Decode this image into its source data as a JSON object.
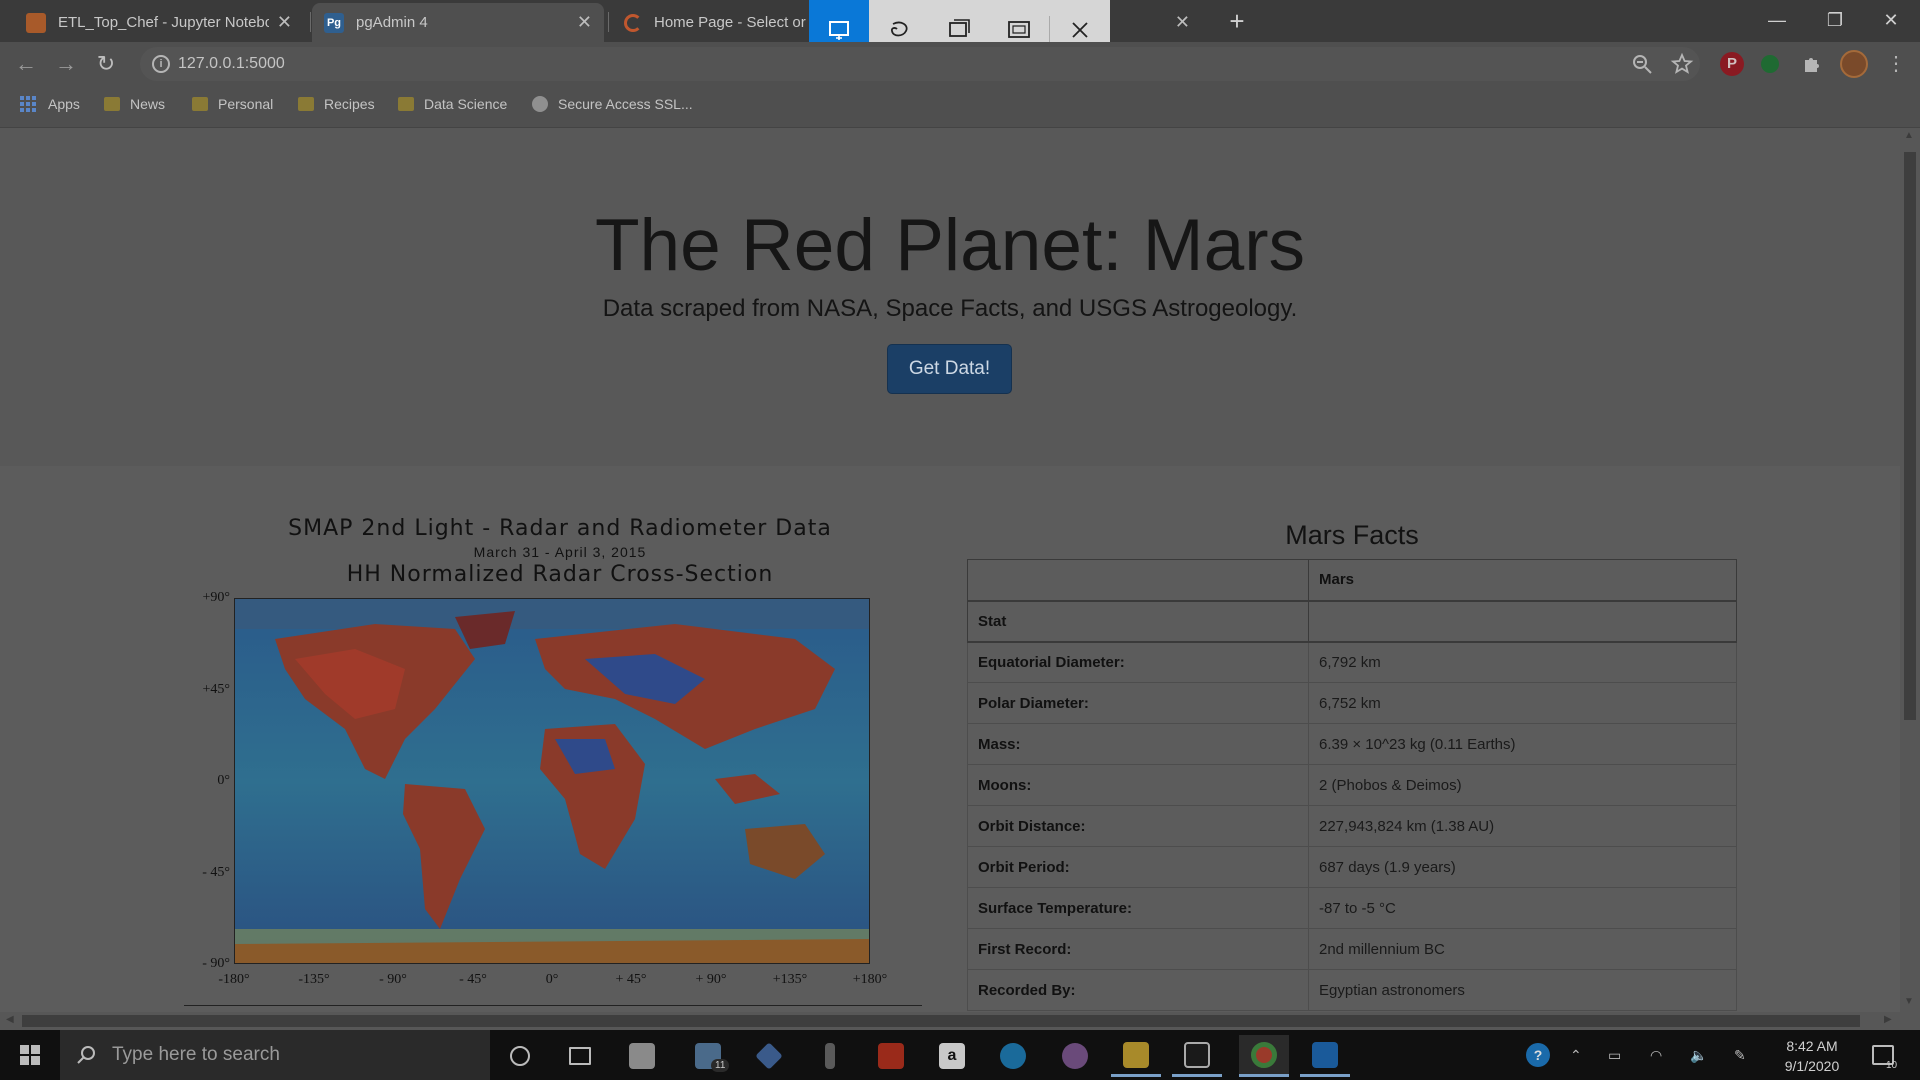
{
  "browser": {
    "tabs": [
      {
        "title": "ETL_Top_Chef - Jupyter Notebook",
        "favicon": "jupyter-icon",
        "color": "#a85a2a"
      },
      {
        "title": "pgAdmin 4",
        "favicon": "pgadmin-icon",
        "color": "#2f5f8f"
      },
      {
        "title": "Home Page - Select or c",
        "favicon": "loading-spinner-icon",
        "color": "#c0572e"
      }
    ],
    "url": "127.0.0.1:5000",
    "bookmarks": [
      {
        "label": "Apps",
        "icon": "apps-grid-icon"
      },
      {
        "label": "News",
        "icon": "folder-icon"
      },
      {
        "label": "Personal",
        "icon": "folder-icon"
      },
      {
        "label": "Recipes",
        "icon": "folder-icon"
      },
      {
        "label": "Data Science",
        "icon": "folder-icon"
      },
      {
        "label": "Secure Access SSL...",
        "icon": "globe-icon"
      }
    ]
  },
  "snip_toolbar": {
    "modes": [
      "rectangular-snip-icon",
      "freeform-snip-icon",
      "window-snip-icon",
      "fullscreen-snip-icon",
      "close-icon"
    ],
    "active_mode": "rectangular-snip-icon",
    "accent": "#0a78d7"
  },
  "page": {
    "title": "The Red Planet: Mars",
    "subtitle": "Data scraped from NASA, Space Facts, and USGS Astrogeology.",
    "button": "Get Data!",
    "button_color": "#1b3f66"
  },
  "smap": {
    "title": "SMAP 2nd Light - Radar and Radiometer Data",
    "date": "March 31 - April 3, 2015",
    "subtitle": "HH Normalized Radar Cross-Section",
    "y_ticks": [
      "+90°",
      "+45°",
      "0°",
      "- 45°",
      "- 90°"
    ],
    "x_ticks": [
      "-180°",
      "-135°",
      "- 90°",
      "- 45°",
      "0°",
      "+ 45°",
      "+ 90°",
      "+135°",
      "+180°"
    ]
  },
  "facts": {
    "title": "Mars Facts",
    "header": [
      "",
      "Mars"
    ],
    "index_label": "Stat",
    "rows": [
      {
        "stat": "Equatorial Diameter:",
        "value": "6,792 km"
      },
      {
        "stat": "Polar Diameter:",
        "value": "6,752 km"
      },
      {
        "stat": "Mass:",
        "value": "6.39 × 10^23 kg (0.11 Earths)"
      },
      {
        "stat": "Moons:",
        "value": "2 (Phobos & Deimos)"
      },
      {
        "stat": "Orbit Distance:",
        "value": "227,943,824 km (1.38 AU)"
      },
      {
        "stat": "Orbit Period:",
        "value": "687 days (1.9 years)"
      },
      {
        "stat": "Surface Temperature:",
        "value": "-87 to -5 °C"
      },
      {
        "stat": "First Record:",
        "value": "2nd millennium BC"
      },
      {
        "stat": "Recorded By:",
        "value": "Egyptian astronomers"
      }
    ]
  },
  "taskbar": {
    "search_placeholder": "Type here to search",
    "mail_badge": "11",
    "time": "8:42 AM",
    "date": "9/1/2020",
    "notification_count": "10"
  }
}
